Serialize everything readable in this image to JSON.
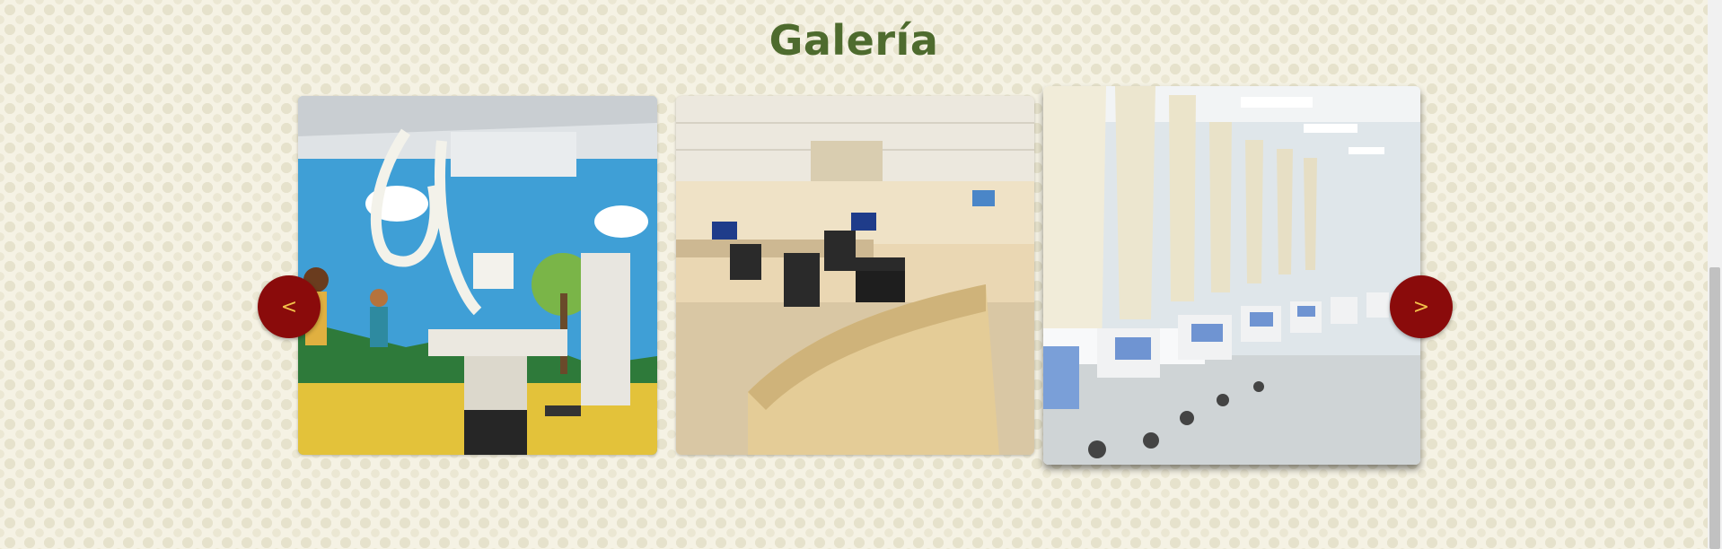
{
  "gallery": {
    "title": "Galería",
    "prev_label": "<",
    "next_label": ">",
    "images": [
      {
        "name": "pediatric-xray-room"
      },
      {
        "name": "nursing-station"
      },
      {
        "name": "hospital-ward-beds"
      }
    ]
  },
  "colors": {
    "background": "#f5f2e4",
    "title": "#4e6b2e",
    "nav_button": "#8a0b0b",
    "nav_arrow": "#f3c24a"
  }
}
